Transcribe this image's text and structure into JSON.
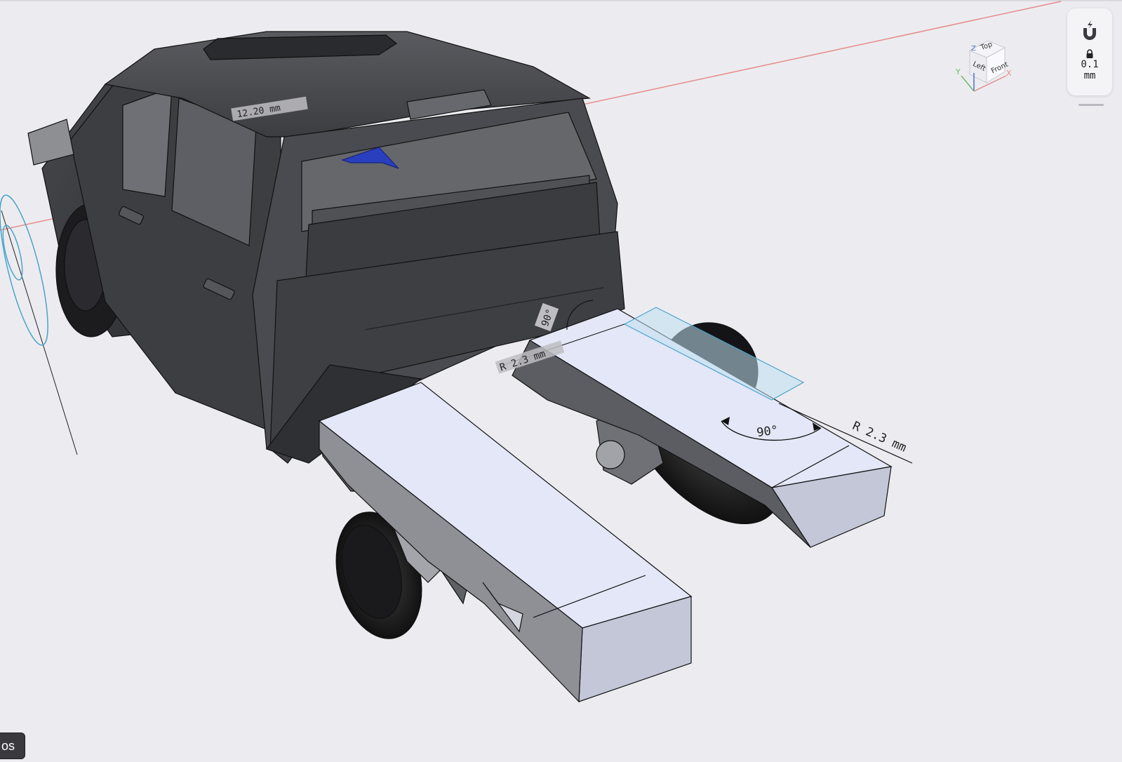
{
  "viewport": {
    "dimensions": {
      "angle_back": "90°",
      "radius_back": "R 2.3 mm",
      "angle_front": "90°",
      "radius_front": "R 2.3 mm",
      "roof_length": "12.20 mm"
    }
  },
  "side_panel": {
    "magnet_icon": "magnet-snap-icon",
    "lock_icon": "lock-icon",
    "snap_value": "0.1",
    "snap_unit": "mm"
  },
  "view_cube": {
    "top": "Top",
    "left": "Left",
    "front": "Front",
    "axis_x": "X",
    "axis_y": "Y",
    "axis_z": "Z"
  },
  "bottom_button": {
    "label": "os"
  },
  "colors": {
    "background": "#ececf0",
    "x_axis": "#e58c8c",
    "part_face": "#e3e7f7",
    "truck_body": "#4a4b4f",
    "selection": "#bfe0f0"
  }
}
